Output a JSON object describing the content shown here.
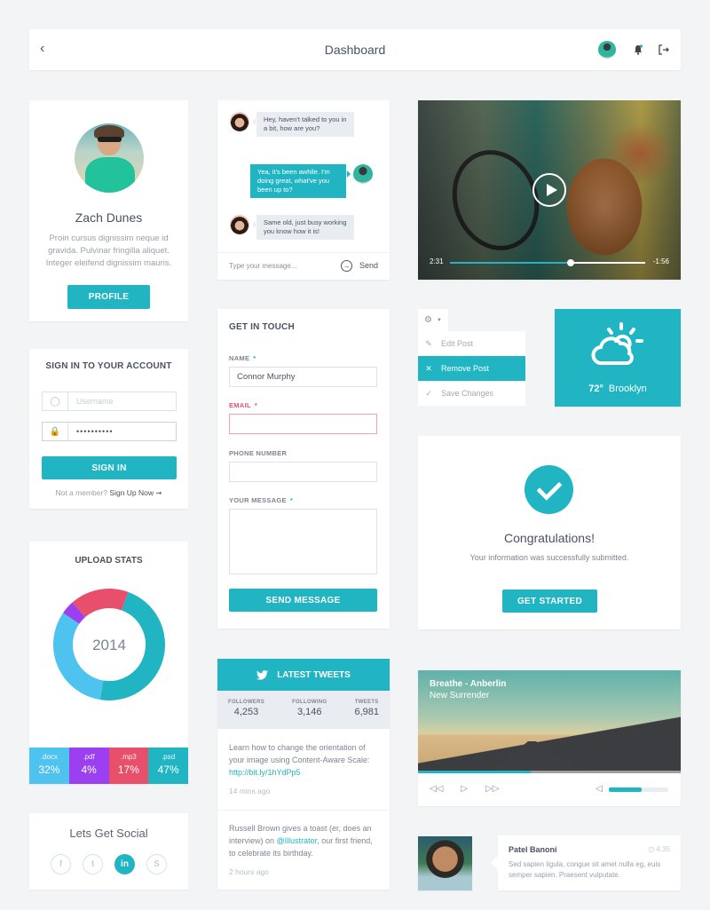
{
  "header": {
    "title": "Dashboard",
    "icons": [
      "chevron-left-icon",
      "avatar",
      "bell-icon",
      "logout-icon"
    ]
  },
  "colors": {
    "accent": "#21b5c4",
    "error": "#e8516e",
    "docx": "#4fc3f0",
    "pdf": "#9c3ff0",
    "mp3": "#e84f6a",
    "psd": "#21b5c4"
  },
  "profile": {
    "name": "Zach Dunes",
    "bio": "Proin cursus dignissim neque id gravida. Pulvinar fringilla aliquet. Integer eleifend dignissim mauris.",
    "button": "PROFILE"
  },
  "signin": {
    "title": "SIGN IN TO YOUR ACCOUNT",
    "username_placeholder": "Username",
    "password_value": "••••••••••",
    "button": "SIGN IN",
    "member_prompt": "Not a member?",
    "signup_link": "Sign Up Now",
    "arrow": "➞"
  },
  "upload": {
    "title": "UPLOAD STATS",
    "center_label": "2014",
    "stats": [
      {
        "ext": ".docx",
        "pct": "32%",
        "value": 32
      },
      {
        "ext": ".pdf",
        "pct": "4%",
        "value": 4
      },
      {
        "ext": ".mp3",
        "pct": "17%",
        "value": 17
      },
      {
        "ext": ".psd",
        "pct": "47%",
        "value": 47
      }
    ]
  },
  "social": {
    "title": "Lets Get Social",
    "icons": [
      {
        "name": "facebook-icon",
        "glyph": "f"
      },
      {
        "name": "twitter-icon",
        "glyph": "t"
      },
      {
        "name": "linkedin-icon",
        "glyph": "in"
      },
      {
        "name": "skype-icon",
        "glyph": "S"
      }
    ]
  },
  "chat": {
    "messages": [
      {
        "from": "them",
        "text": "Hey, haven't talked to you in a bit, how are you?"
      },
      {
        "from": "me",
        "text": "Yea, it's been awhile. I'm doing great, what've you been up to?"
      },
      {
        "from": "them",
        "text": "Same old, just busy working you know how it is!"
      }
    ],
    "placeholder": "Type your message...",
    "send_label": "Send"
  },
  "contact": {
    "title": "GET IN TOUCH",
    "fields": [
      {
        "label": "NAME",
        "required": "*",
        "value": ""
      },
      {
        "label": "EMAIL",
        "required": "*",
        "value": ""
      },
      {
        "label": "PHONE NUMBER",
        "required": "",
        "value": ""
      },
      {
        "label": "YOUR MESSAGE",
        "required": "*",
        "value": ""
      }
    ],
    "name_value": "Connor Murphy",
    "button": "SEND MESSAGE"
  },
  "tweets": {
    "title": "LATEST TWEETS",
    "counts": [
      {
        "label": "FOLLOWERS",
        "value": "4,253"
      },
      {
        "label": "FOLLOWING",
        "value": "3,146"
      },
      {
        "label": "TWEETS",
        "value": "6,981"
      }
    ],
    "items": [
      {
        "text": "Learn how to change the orientation of your image using Content-Aware Scale: ",
        "link": "http://bit.ly/1hYdPp5",
        "after": "",
        "time": "14 mins ago"
      },
      {
        "text": "Russell Brown gives a toast (er, does an interview) on ",
        "link": "@Illustrator",
        "after": ", our first friend, to celebrate its birthday.",
        "time": "2 hours ago"
      }
    ]
  },
  "video": {
    "time_elapsed": "2:31",
    "time_remaining": "-1:56",
    "progress_fraction": 0.62
  },
  "dropdown": {
    "items": [
      {
        "icon": "✎",
        "label": "Edit Post",
        "active": false
      },
      {
        "icon": "✕",
        "label": "Remove Post",
        "active": true
      },
      {
        "icon": "✓",
        "label": "Save Changes",
        "active": false
      }
    ]
  },
  "weather": {
    "temp": "72°",
    "city": "Brooklyn"
  },
  "congrats": {
    "title": "Congratulations!",
    "subtitle": "Your information was successfully submitted.",
    "button": "GET STARTED"
  },
  "music": {
    "song": "Breathe - Anberlin",
    "album": "New Surrender",
    "progress_fraction": 0.43,
    "volume_fraction": 0.55
  },
  "comment": {
    "author": "Patel Banoni",
    "time": "4:35",
    "text": "Sed sapien ligula, congue sit amet nulla eg, euis semper sapien. Praesent vulputate."
  }
}
